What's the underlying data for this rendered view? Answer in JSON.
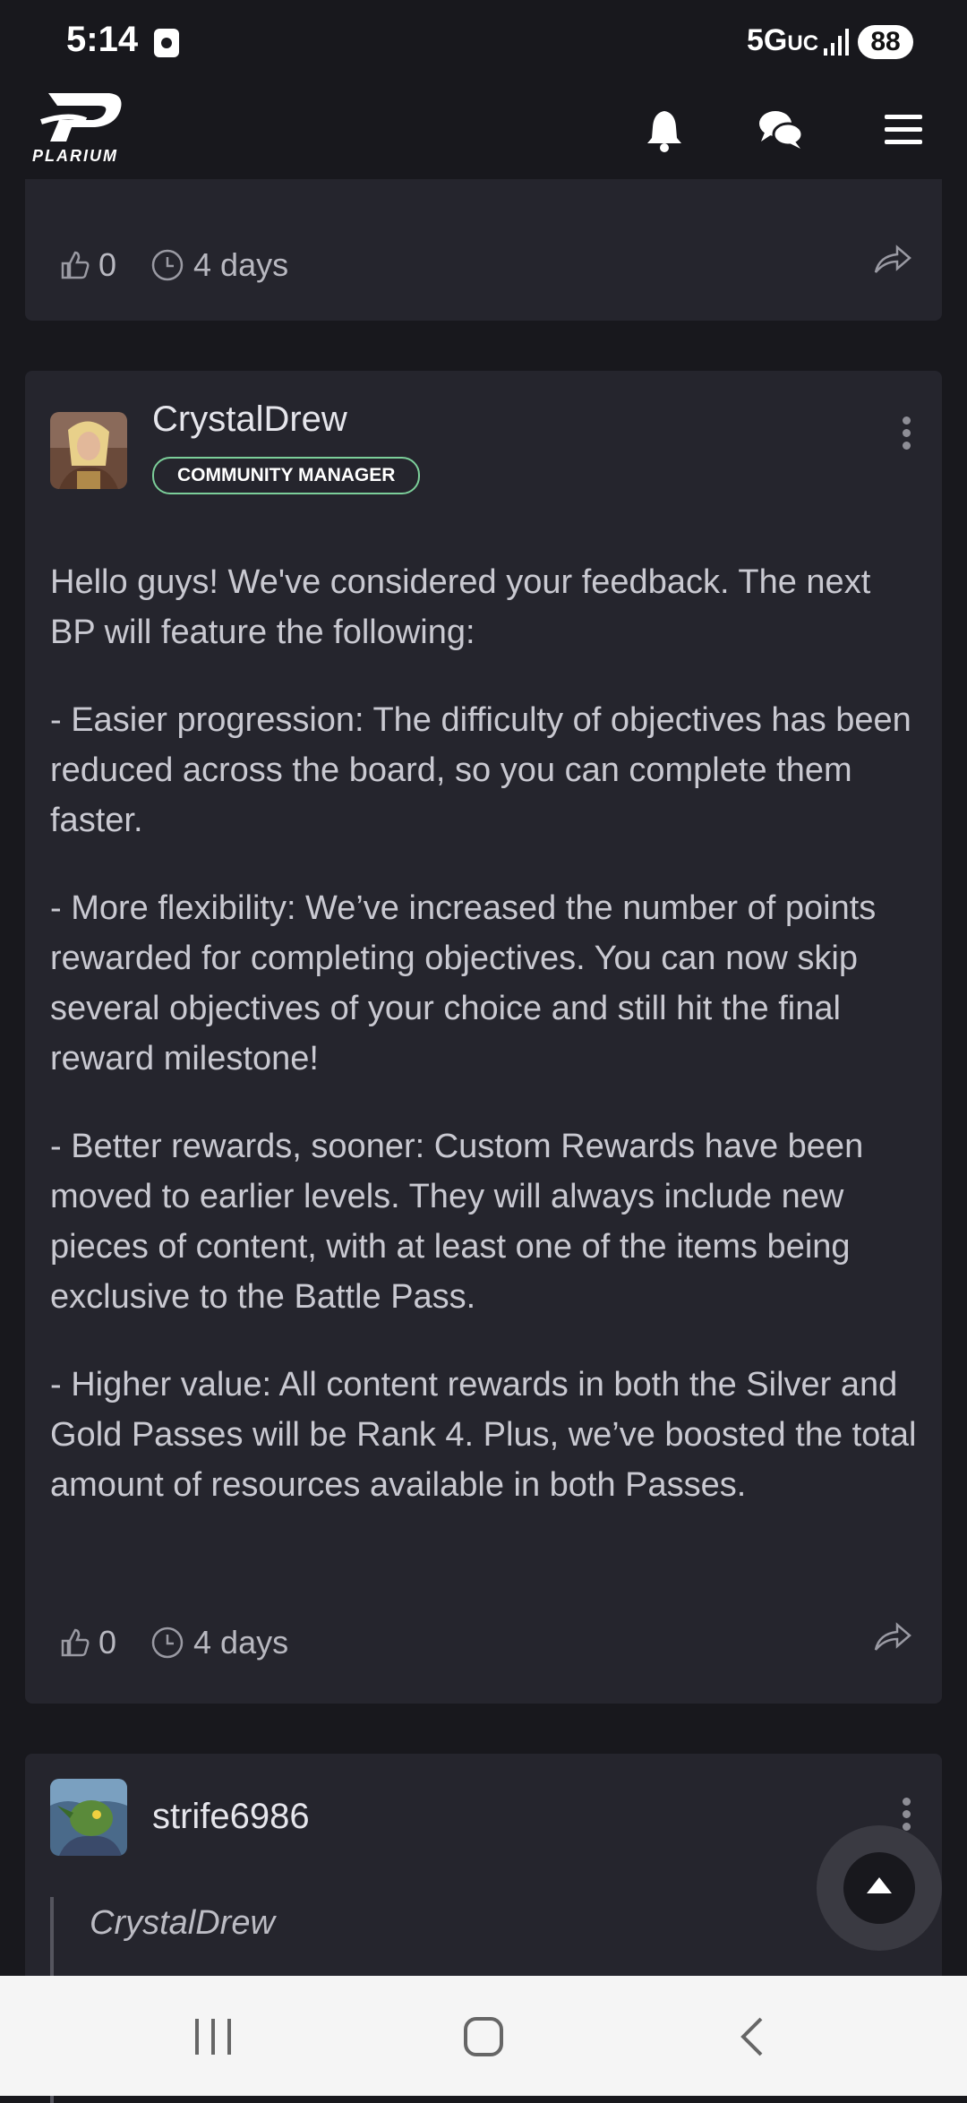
{
  "status_bar": {
    "time": "5:14",
    "network": "5G",
    "network_suffix": "UC",
    "battery": "88"
  },
  "header": {
    "logo_text": "PLARIUM",
    "icons": [
      "bell-icon",
      "chat-icon",
      "hamburger-menu-icon"
    ]
  },
  "posts": [
    {
      "likes": "0",
      "age": "4 days"
    },
    {
      "author": "CrystalDrew",
      "badge": "COMMUNITY MANAGER",
      "paragraphs": [
        "Hello guys! We've considered your feedback. The next BP will feature the following:",
        "- Easier progression: The difficulty of objectives has been reduced across the board, so you can complete them faster.",
        "- More flexibility: We’ve increased the number of points rewarded for completing objectives. You can now skip several objectives of your choice and still hit the final reward milestone!",
        "- Better rewards, sooner: Custom Rewards have been moved to earlier levels. They will always include new pieces of content, with at least one of the items being exclusive to the Battle Pass.",
        "- Higher value: All content rewards in both the Silver and Gold Passes will be Rank 4. Plus, we’ve boosted the total amount of resources available in both Passes."
      ],
      "likes": "0",
      "age": "4 days"
    },
    {
      "author": "strife6986",
      "quote_author": "CrystalDrew"
    }
  ],
  "colors": {
    "background": "#18181d",
    "card": "#25252d",
    "badge_border": "#7ccf9a",
    "nav_bar": "#f5f5f5"
  }
}
